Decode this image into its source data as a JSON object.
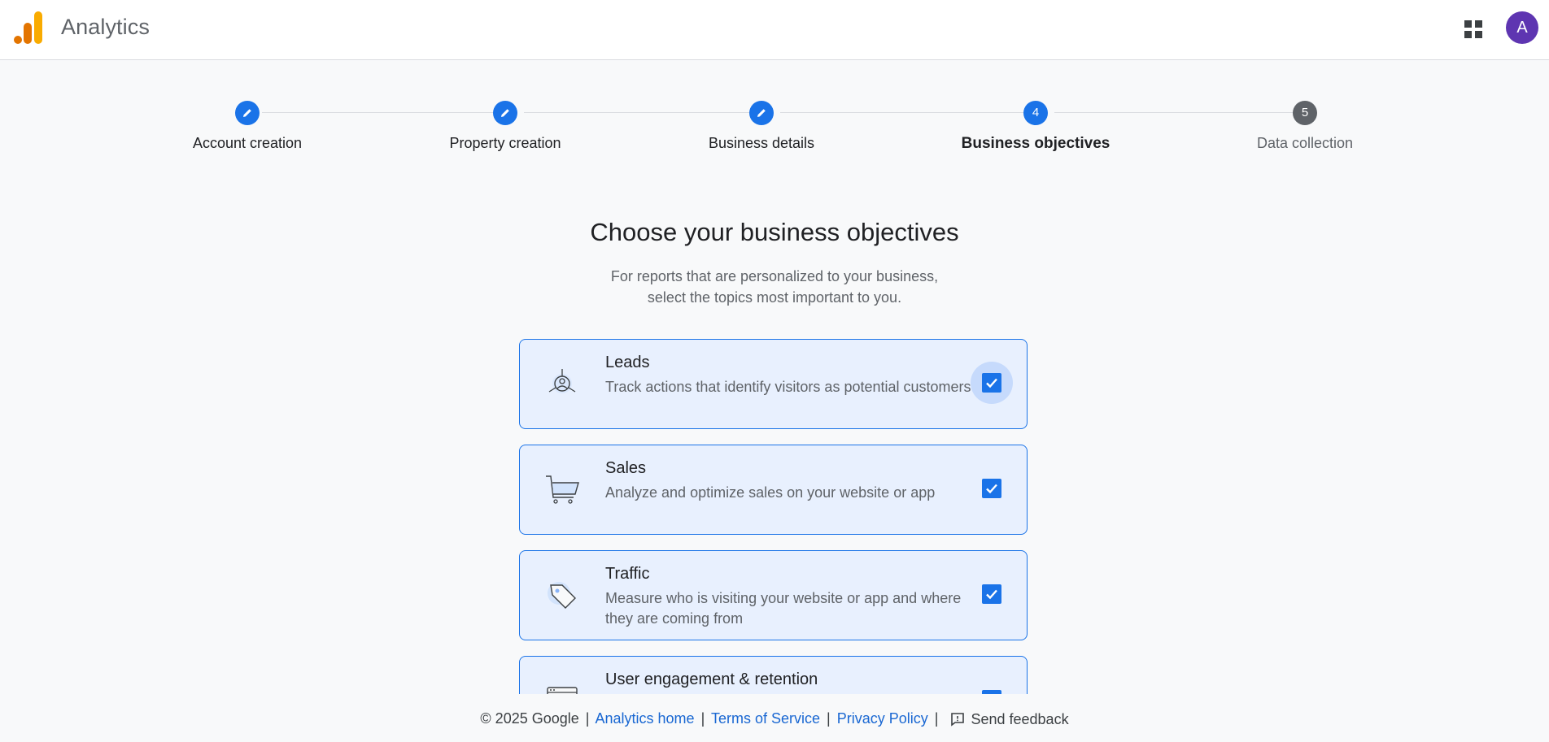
{
  "header": {
    "app_title": "Analytics",
    "logo_icon": "analytics-logo",
    "apps_icon": "apps-grid-icon",
    "avatar_letter": "A"
  },
  "stepper": {
    "steps": [
      {
        "label": "Account creation",
        "state": "completed",
        "icon": "pencil-icon"
      },
      {
        "label": "Property creation",
        "state": "completed",
        "icon": "pencil-icon"
      },
      {
        "label": "Business details",
        "state": "completed",
        "icon": "pencil-icon"
      },
      {
        "label": "Business objectives",
        "state": "active",
        "number": "4"
      },
      {
        "label": "Data collection",
        "state": "pending",
        "number": "5"
      }
    ]
  },
  "main": {
    "title": "Choose your business objectives",
    "subtitle_line1": "For reports that are personalized to your business,",
    "subtitle_line2": "select the topics most important to you."
  },
  "objectives": [
    {
      "title": "Leads",
      "description": "Track actions that identify visitors as potential customers",
      "checked": true,
      "icon": "leads-target-icon"
    },
    {
      "title": "Sales",
      "description": "Analyze and optimize sales on your website or app",
      "checked": true,
      "icon": "shopping-cart-icon"
    },
    {
      "title": "Traffic",
      "description": "Measure who is visiting your website or app and where they are coming from",
      "checked": true,
      "icon": "price-tag-icon"
    },
    {
      "title": "User engagement & retention",
      "description": "",
      "checked": true,
      "icon": "browser-window-icon"
    }
  ],
  "footer": {
    "copyright": "© 2025 Google",
    "analytics_home": "Analytics home",
    "terms": "Terms of Service",
    "privacy": "Privacy Policy",
    "feedback": "Send feedback",
    "separator": "|"
  },
  "colors": {
    "accent": "#1a73e8",
    "card_bg": "#e8f0fe",
    "avatar_bg": "#5e35b1",
    "logo_orange": "#f9ab00",
    "logo_dark_orange": "#e37400"
  }
}
